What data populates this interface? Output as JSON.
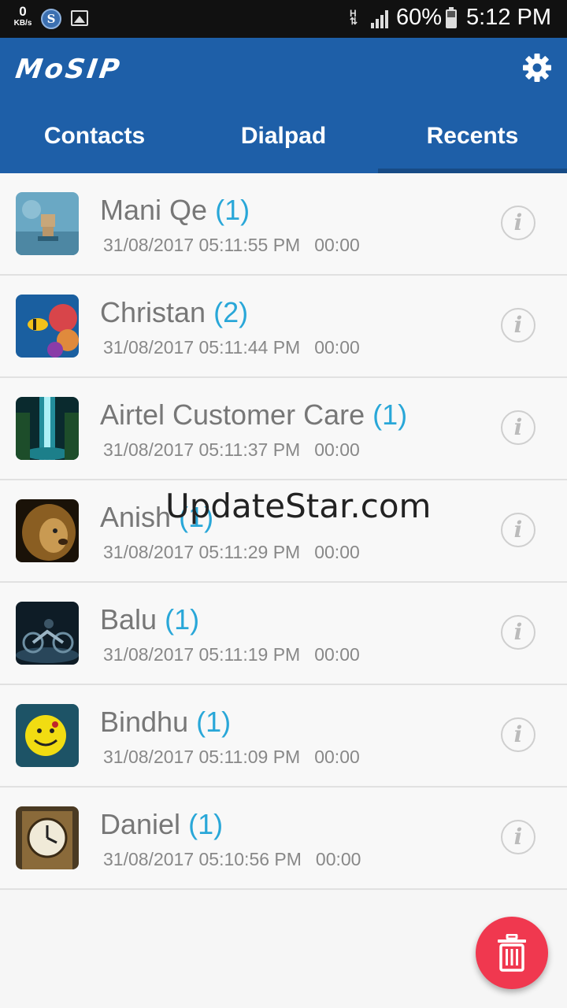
{
  "status_bar": {
    "net_speed": "0",
    "net_unit": "KB/s",
    "s_badge": "S",
    "network_type": "H",
    "battery": "60%",
    "time": "5:12 PM"
  },
  "app_bar": {
    "logo": "MoSIP",
    "tabs": [
      {
        "label": "Contacts"
      },
      {
        "label": "Dialpad"
      },
      {
        "label": "Recents"
      }
    ],
    "active_tab": "Recents"
  },
  "recents": [
    {
      "name": "Mani Qe",
      "count": "(1)",
      "datetime": "31/08/2017 05:11:55 PM",
      "duration": "00:00",
      "avatar": "toy-figure"
    },
    {
      "name": "Christan",
      "count": "(2)",
      "datetime": "31/08/2017 05:11:44 PM",
      "duration": "00:00",
      "avatar": "coral-fish"
    },
    {
      "name": "Airtel Customer Care",
      "count": "(1)",
      "datetime": "31/08/2017 05:11:37 PM",
      "duration": "00:00",
      "avatar": "waterfall"
    },
    {
      "name": "Anish",
      "count": "(1)",
      "datetime": "31/08/2017 05:11:29 PM",
      "duration": "00:00",
      "avatar": "lion"
    },
    {
      "name": "Balu",
      "count": "(1)",
      "datetime": "31/08/2017 05:11:19 PM",
      "duration": "00:00",
      "avatar": "motorbike"
    },
    {
      "name": "Bindhu",
      "count": "(1)",
      "datetime": "31/08/2017 05:11:09 PM",
      "duration": "00:00",
      "avatar": "smiley"
    },
    {
      "name": "Daniel",
      "count": "(1)",
      "datetime": "31/08/2017 05:10:56 PM",
      "duration": "00:00",
      "avatar": "clock-tower"
    }
  ],
  "info_glyph": "i",
  "watermark": "UpdateStar.com",
  "colors": {
    "app_bar": "#1e5fa8",
    "accent_count": "#29a7d8",
    "fab": "#f0384f"
  },
  "icons": {
    "settings": "gear-icon",
    "info": "info-icon",
    "delete": "trash-icon"
  }
}
